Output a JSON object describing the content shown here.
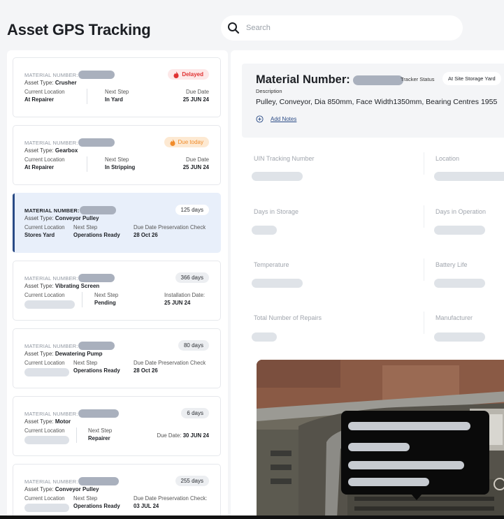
{
  "page": {
    "title": "Asset GPS Tracking"
  },
  "search": {
    "placeholder": "Search"
  },
  "cards": [
    {
      "material_label": "MATERIAL NUMBER:",
      "asset_type_label": "Asset Type:",
      "asset_type": "Crusher",
      "location_label": "Current Location",
      "location": "At Repairer",
      "next_label": "Next Step",
      "next": "In Yard",
      "due_label": "Due Date",
      "due": "25 JUN 24",
      "badge": "Delayed"
    },
    {
      "material_label": "MATERIAL NUMBER:",
      "asset_type_label": "Asset Type:",
      "asset_type": "Gearbox",
      "location_label": "Current Location",
      "location": "At Repairer",
      "next_label": "Next Step",
      "next": "In Stripping",
      "due_label": "Due Date",
      "due": "25 JUN 24",
      "badge": "Due today"
    },
    {
      "material_label": "MATERIAL NUMBER:",
      "asset_type_label": "Asset Type:",
      "asset_type": "Conveyor Pulley",
      "location_label": "Current Location",
      "location": "Stores Yard",
      "next_label": "Next Step",
      "next": "Operations Ready",
      "due_label": "Due Date Preservation Check",
      "due": "28 Oct 26",
      "badge": "125 days"
    },
    {
      "material_label": "MATERIAL NUMBER:",
      "asset_type_label": "Asset Type:",
      "asset_type": "Vibrating Screen",
      "location_label": "Current Location",
      "next_label": "Next Step",
      "next": "Pending",
      "due_label": "Installation Date:",
      "due": "25 JUN 24",
      "badge": "366 days"
    },
    {
      "material_label": "MATERIAL NUMBER:",
      "asset_type_label": "Asset Type:",
      "asset_type": "Dewatering Pump",
      "location_label": "Current Location",
      "next_label": "Next Step",
      "next": "Operations Ready",
      "due_label": "Due Date Preservation Check",
      "due": "28 Oct 26",
      "badge": "80 days"
    },
    {
      "material_label": "MATERIAL NUMBER:",
      "asset_type_label": "Asset Type:",
      "asset_type": "Motor",
      "location_label": "Current Location",
      "next_label": "Next Step",
      "next": "Repairer",
      "due_label": "Due Date:",
      "due": "30 JUN 24",
      "badge": "6 days"
    },
    {
      "material_label": "MATERIAL NUMBER:",
      "asset_type_label": "Asset Type:",
      "asset_type": "Conveyor Pulley",
      "location_label": "Current Location",
      "next_label": "Next Step",
      "next": "Operations Ready",
      "due_label": "Due Date Preservation Check:",
      "due": "03 JUL 24",
      "badge": "255 days"
    }
  ],
  "detail": {
    "title_label": "Material Number:",
    "tracker_status_label": "Tracker Status",
    "tracker_status": "At Site Storage Yard",
    "description_label": "Description",
    "description": "Pulley, Conveyor, Dia 850mm, Face Width1350mm, Bearing Centres 1955",
    "add_notes": "Add Notes",
    "fields": {
      "uin": "UIN Tracking Number",
      "location": "Location",
      "days_storage": "Days in Storage",
      "days_operation": "Days in Operation",
      "temperature": "Temperature",
      "battery": "Battery Life",
      "repairs": "Total Number of Repairs",
      "manufacturer": "Manufacturer"
    }
  },
  "colors": {
    "accent": "#2a4b86",
    "delayed": "#e03131",
    "due_today": "#f08c2b"
  }
}
